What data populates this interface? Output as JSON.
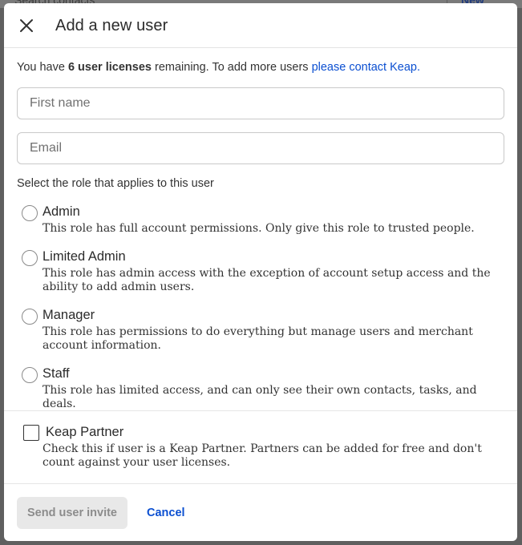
{
  "background": {
    "search_text": "Search contacts",
    "new_button": "New"
  },
  "modal": {
    "title": "Add a new user",
    "license_notice": {
      "prefix": "You have ",
      "count": "6 user licenses",
      "middle": " remaining. To add more users ",
      "link": "please contact Keap."
    },
    "fields": {
      "first_name_placeholder": "First name",
      "email_placeholder": "Email"
    },
    "role_prompt": "Select the role that applies to this user",
    "roles": [
      {
        "name": "Admin",
        "description": "This role has full account permissions. Only give this role to trusted people."
      },
      {
        "name": "Limited Admin",
        "description": "This role has admin access with the exception of account setup access and the ability to add admin users."
      },
      {
        "name": "Manager",
        "description": "This role has permissions to do everything but manage users and merchant account information."
      },
      {
        "name": "Staff",
        "description": "This role has limited access, and can only see their own contacts, tasks, and deals."
      }
    ],
    "partner": {
      "label": "Keap Partner",
      "description": "Check this if user is a Keap Partner. Partners can be added for free and don't count against your user licenses."
    },
    "actions": {
      "send_label": "Send user invite",
      "cancel_label": "Cancel"
    }
  },
  "colors": {
    "link": "#0b4fd1",
    "overlay": "#5f5f5f",
    "disabled_button_bg": "#e8e8e8"
  }
}
